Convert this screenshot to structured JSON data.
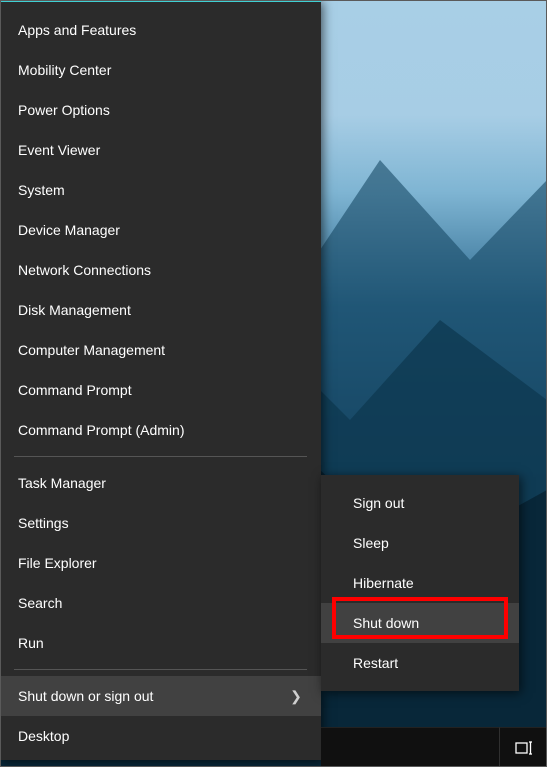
{
  "menu": {
    "group1": [
      {
        "label": "Apps and Features"
      },
      {
        "label": "Mobility Center"
      },
      {
        "label": "Power Options"
      },
      {
        "label": "Event Viewer"
      },
      {
        "label": "System"
      },
      {
        "label": "Device Manager"
      },
      {
        "label": "Network Connections"
      },
      {
        "label": "Disk Management"
      },
      {
        "label": "Computer Management"
      },
      {
        "label": "Command Prompt"
      },
      {
        "label": "Command Prompt (Admin)"
      }
    ],
    "group2": [
      {
        "label": "Task Manager"
      },
      {
        "label": "Settings"
      },
      {
        "label": "File Explorer"
      },
      {
        "label": "Search"
      },
      {
        "label": "Run"
      }
    ],
    "group3": [
      {
        "label": "Shut down or sign out",
        "submenu": true,
        "hovered": true
      },
      {
        "label": "Desktop"
      }
    ]
  },
  "submenu": {
    "items": [
      {
        "label": "Sign out"
      },
      {
        "label": "Sleep"
      },
      {
        "label": "Hibernate"
      },
      {
        "label": "Shut down",
        "highlighted": true,
        "annotated": true
      },
      {
        "label": "Restart"
      }
    ]
  },
  "icons": {
    "chevron": "❯"
  }
}
